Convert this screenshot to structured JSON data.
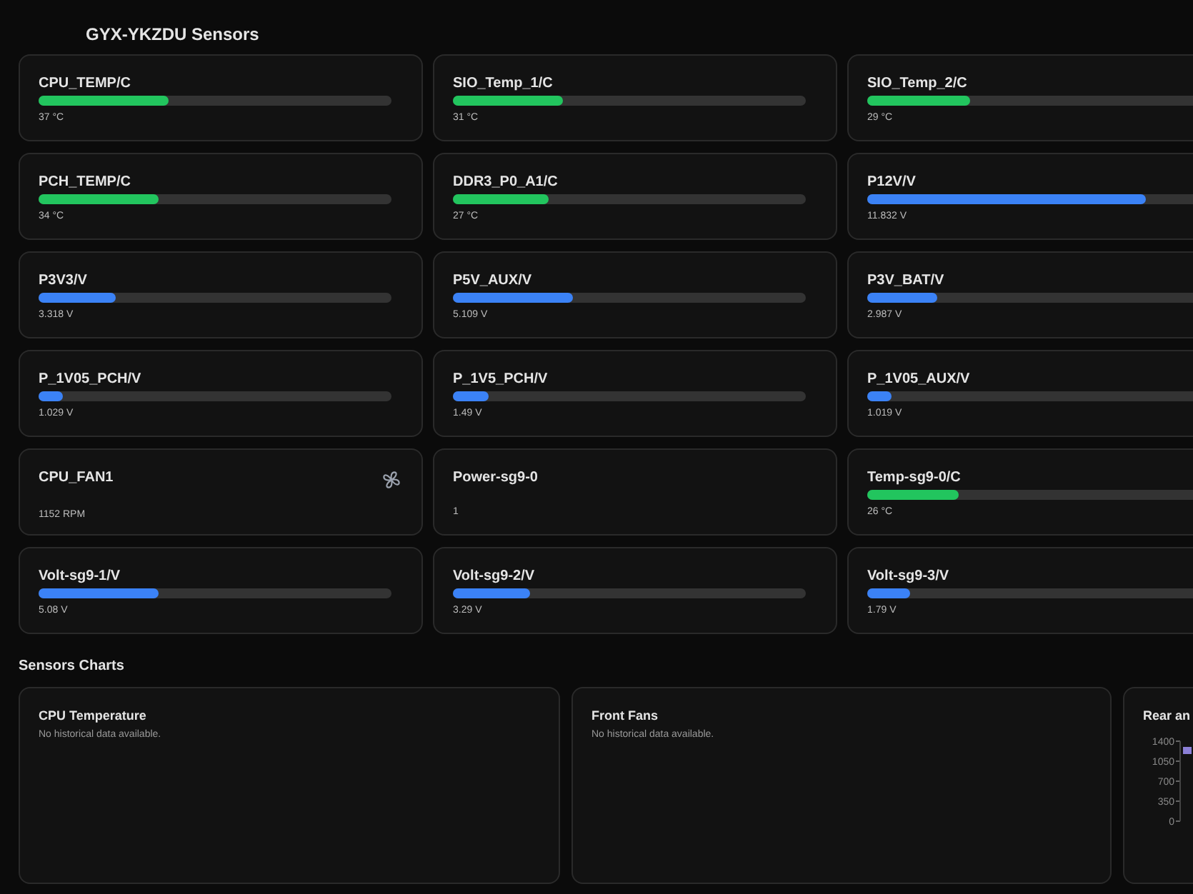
{
  "title": "GYX-YKZDU Sensors",
  "sensors": [
    {
      "kind": "bar",
      "label": "CPU_TEMP/C",
      "level": 0.37,
      "color": "#22c55e",
      "reading": "37 °C"
    },
    {
      "kind": "bar",
      "label": "SIO_Temp_1/C",
      "level": 0.31,
      "color": "#22c55e",
      "reading": "31 °C"
    },
    {
      "kind": "bar",
      "label": "SIO_Temp_2/C",
      "level": 0.29,
      "color": "#22c55e",
      "reading": "29 °C"
    },
    {
      "kind": "bar",
      "label": "PCH_TEMP/C",
      "level": 0.34,
      "color": "#22c55e",
      "reading": "34 °C"
    },
    {
      "kind": "bar",
      "label": "DDR3_P0_A1/C",
      "level": 0.27,
      "color": "#22c55e",
      "reading": "27 °C"
    },
    {
      "kind": "bar",
      "label": "P12V/V",
      "level": 0.79,
      "color": "#3b82f6",
      "reading": "11.832 V"
    },
    {
      "kind": "bar",
      "label": "P3V3/V",
      "level": 0.22,
      "color": "#3b82f6",
      "reading": "3.318 V"
    },
    {
      "kind": "bar",
      "label": "P5V_AUX/V",
      "level": 0.34,
      "color": "#3b82f6",
      "reading": "5.109 V"
    },
    {
      "kind": "bar",
      "label": "P3V_BAT/V",
      "level": 0.2,
      "color": "#3b82f6",
      "reading": "2.987 V"
    },
    {
      "kind": "bar",
      "label": "P_1V05_PCH/V",
      "level": 0.07,
      "color": "#3b82f6",
      "reading": "1.029 V"
    },
    {
      "kind": "bar",
      "label": "P_1V5_PCH/V",
      "level": 0.1,
      "color": "#3b82f6",
      "reading": "1.49 V"
    },
    {
      "kind": "bar",
      "label": "P_1V05_AUX/V",
      "level": 0.07,
      "color": "#3b82f6",
      "reading": "1.019 V"
    },
    {
      "kind": "fan",
      "label": "CPU_FAN1",
      "reading": "1152 RPM"
    },
    {
      "kind": "plain",
      "label": "Power-sg9-0",
      "reading": "1"
    },
    {
      "kind": "bar",
      "label": "Temp-sg9-0/C",
      "level": 0.26,
      "color": "#22c55e",
      "reading": "26 °C"
    },
    {
      "kind": "bar",
      "label": "Volt-sg9-1/V",
      "level": 0.34,
      "color": "#3b82f6",
      "reading": "5.08 V"
    },
    {
      "kind": "bar",
      "label": "Volt-sg9-2/V",
      "level": 0.22,
      "color": "#3b82f6",
      "reading": "3.29 V"
    },
    {
      "kind": "bar",
      "label": "Volt-sg9-3/V",
      "level": 0.12,
      "color": "#3b82f6",
      "reading": "1.79 V"
    }
  ],
  "charts_heading": "Sensors Charts",
  "charts": [
    {
      "title": "CPU Temperature",
      "message": "No historical data available."
    },
    {
      "title": "Front Fans",
      "message": "No historical data available."
    },
    {
      "title": "Rear an",
      "axis_labels": [
        "1400",
        "1050",
        "700",
        "350",
        "0"
      ]
    }
  ]
}
